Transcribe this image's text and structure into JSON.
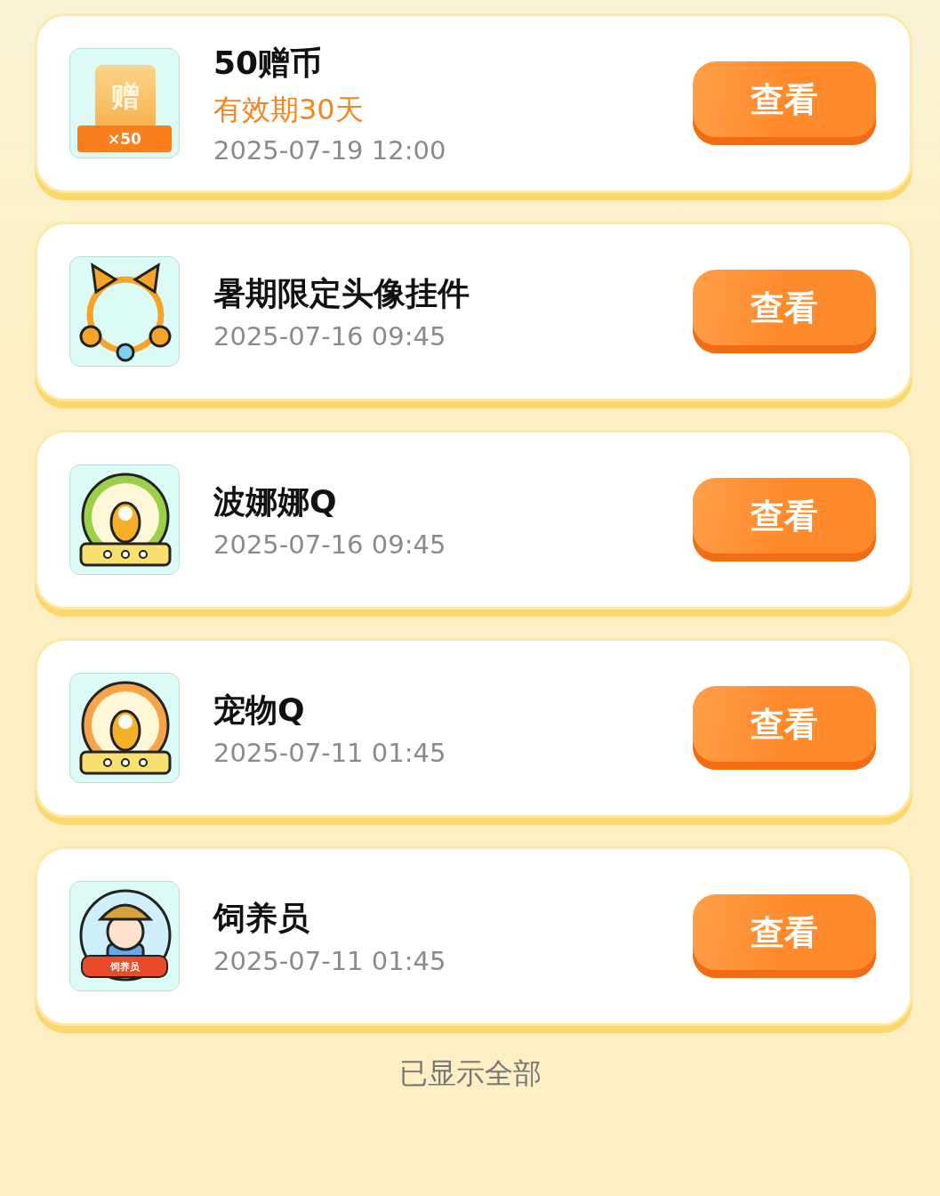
{
  "items": [
    {
      "title": "50赠币",
      "validity": "有效期30天",
      "time": "2025-07-19 12:00",
      "button": "查看",
      "icon": {
        "kind": "ticket",
        "glyph": "赠",
        "count": "×50"
      }
    },
    {
      "title": "暑期限定头像挂件",
      "time": "2025-07-16 09:45",
      "button": "查看",
      "icon": {
        "kind": "frame"
      }
    },
    {
      "title": "波娜娜Q",
      "time": "2025-07-16 09:45",
      "button": "查看",
      "icon": {
        "kind": "globe",
        "color": "#9ccf4a"
      }
    },
    {
      "title": "宠物Q",
      "time": "2025-07-11 01:45",
      "button": "查看",
      "icon": {
        "kind": "globe",
        "color": "#f6a34a"
      }
    },
    {
      "title": "饲养员",
      "time": "2025-07-11 01:45",
      "button": "查看",
      "icon": {
        "kind": "badge",
        "label": "饲养员"
      }
    }
  ],
  "footer": "已显示全部"
}
